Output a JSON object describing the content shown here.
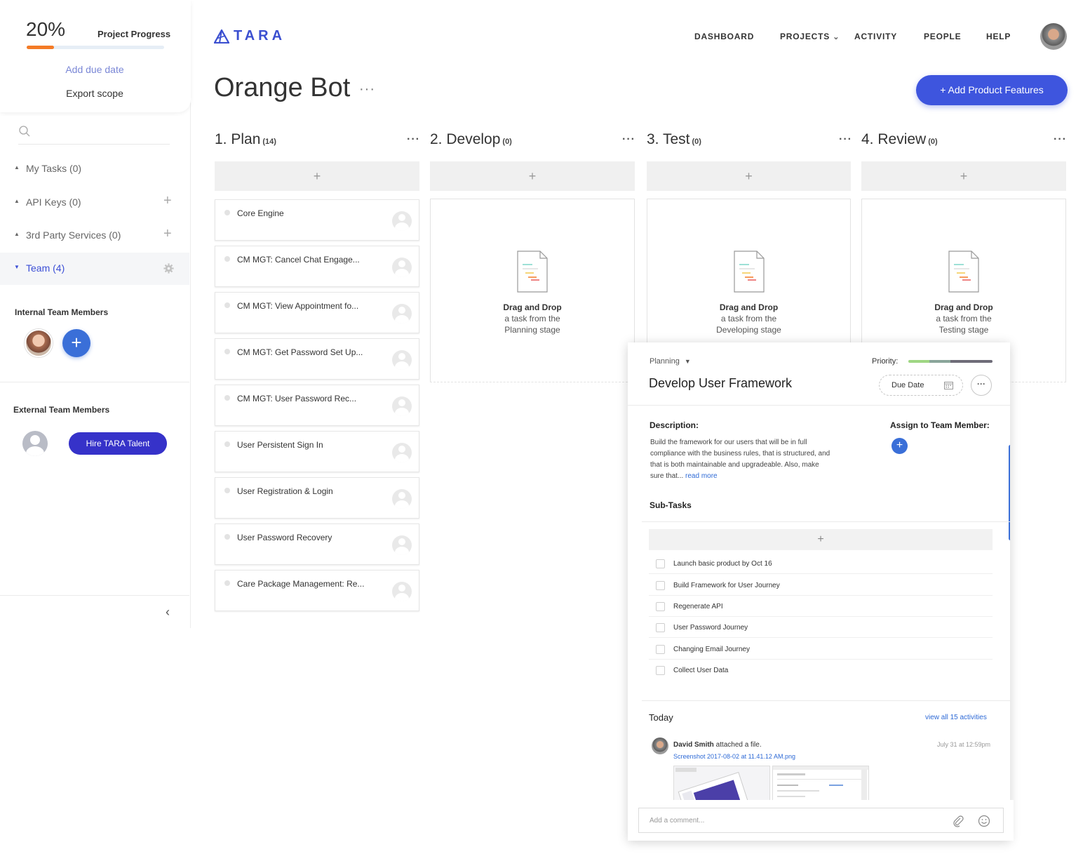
{
  "project": {
    "progress_pct": "20%",
    "progress_value": 0.2,
    "progress_label": "Project Progress",
    "add_due_date": "Add due date",
    "export_scope": "Export scope"
  },
  "sidebar": {
    "items": [
      {
        "label": "My Tasks (0)"
      },
      {
        "label": "API Keys (0)"
      },
      {
        "label": "3rd Party Services (0)"
      },
      {
        "label": "Team (4)"
      }
    ],
    "internal_title": "Internal Team Members",
    "external_title": "External Team Members",
    "hire_label": "Hire TARA Talent",
    "add_symbol": "+",
    "collapse_symbol": "‹"
  },
  "header": {
    "logo": "TARA",
    "nav": [
      "DASHBOARD",
      "PROJECTS",
      "ACTIVITY",
      "PEOPLE",
      "HELP"
    ],
    "projects_caret": "⌄"
  },
  "page": {
    "title": "Orange Bot",
    "title_menu": "···",
    "add_features": "+ Add Product Features"
  },
  "columns": [
    {
      "name": "1. Plan",
      "count": "(14)",
      "add": "+",
      "menu": "···"
    },
    {
      "name": "2. Develop",
      "count": "(0)",
      "add": "+",
      "menu": "···"
    },
    {
      "name": "3. Test",
      "count": "(0)",
      "add": "+",
      "menu": "···"
    },
    {
      "name": "4. Review",
      "count": "(0)",
      "add": "+",
      "menu": "···"
    }
  ],
  "plan_cards": [
    "Core Engine",
    "CM MGT: Cancel Chat Engage...",
    "CM MGT: View Appointment fo...",
    "CM MGT: Get Password Set Up...",
    "CM MGT: User Password Rec...",
    "User Persistent Sign In",
    "User Registration & Login",
    "User Password Recovery",
    "Care Package Management: Re..."
  ],
  "dropzones": [
    {
      "title": "Drag and Drop",
      "line2": "a task from the",
      "line3": "Planning stage"
    },
    {
      "title": "Drag and Drop",
      "line2": "a task from the",
      "line3": "Developing stage"
    },
    {
      "title": "Drag and Drop",
      "line2": "a task from the",
      "line3": "Testing stage"
    }
  ],
  "task": {
    "stage": "Planning",
    "stage_caret": "▼",
    "priority_label": "Priority:",
    "title": "Develop User Framework",
    "due_date": "Due Date",
    "more": "···",
    "description_label": "Description:",
    "description": "Build the framework for our users that will be in full compliance with the business rules, that is structured, and that is both maintainable and upgradeable. Also, make sure that...",
    "read_more": "read more",
    "assign_label": "Assign to Team Member:",
    "assign_add": "+",
    "subtasks_label": "Sub-Tasks",
    "subtask_add": "+",
    "subtasks": [
      "Launch basic product by Oct 16",
      "Build Framework for User Journey",
      "Regenerate API",
      "User Password Journey",
      "Changing Email Journey",
      "Collect User Data"
    ],
    "today_label": "Today",
    "view_all": "view all 15 activities",
    "activity": {
      "user": "David Smith",
      "action": "attached a file.",
      "time": "July 31 at 12:59pm",
      "file": "Screenshot 2017-08-02 at 11.41.12 AM.png"
    },
    "comment_placeholder": "Add a comment..."
  },
  "colors": {
    "accent": "#3e55de",
    "progress": "#f47b26",
    "link": "#2e6ad6",
    "hire": "#3632c9"
  }
}
